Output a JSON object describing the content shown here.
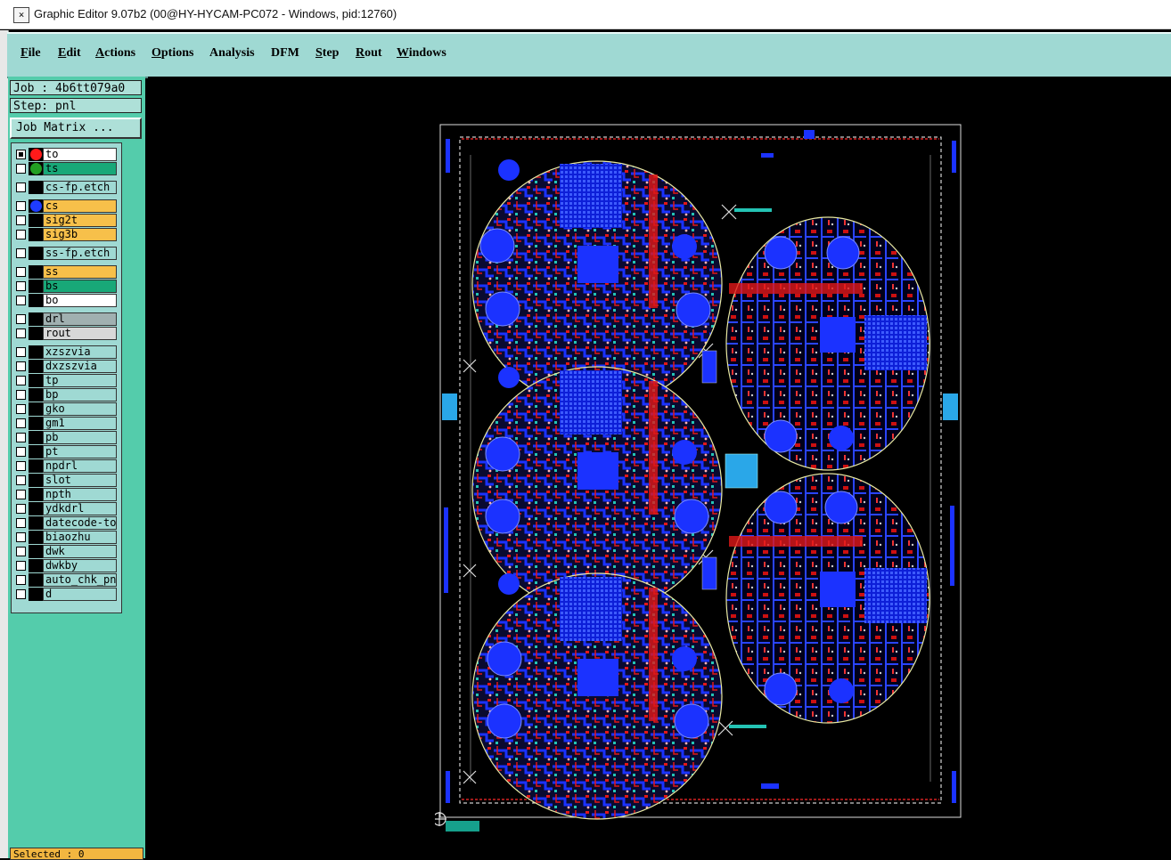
{
  "window": {
    "icon": "app-icon",
    "title": "Graphic Editor 9.07b2 (00@HY-HYCAM-PC072 - Windows, pid:12760)"
  },
  "menu": [
    {
      "first": "F",
      "rest": "ile"
    },
    {
      "first": "E",
      "rest": "dit"
    },
    {
      "first": "A",
      "rest": "ctions"
    },
    {
      "first": "O",
      "rest": "ptions"
    },
    {
      "first": "A",
      "rest": "nalysis"
    },
    {
      "first": "D",
      "rest": "FM"
    },
    {
      "first": "S",
      "rest": "tep"
    },
    {
      "first": "R",
      "rest": "out"
    },
    {
      "first": "W",
      "rest": "indows"
    }
  ],
  "job_label": "Job : 4b6tt079a0",
  "step_label": "Step: pnl",
  "job_matrix_button": "Job Matrix ...",
  "layers": [
    {
      "name": "to",
      "bg": "#ffffff",
      "dot": "#ff1a1a",
      "checked": true
    },
    {
      "name": "ts",
      "bg": "#18a878",
      "dot": "#22a022",
      "checked": false
    },
    {
      "name": "cs-fp.etch",
      "bg": "#9fd9d3",
      "dot": "",
      "checked": false
    },
    {
      "name": "cs",
      "bg": "#f7c04a",
      "dot": "#1e3cff",
      "checked": false
    },
    {
      "name": "sig2t",
      "bg": "#f7c04a",
      "dot": "",
      "checked": false
    },
    {
      "name": "sig3b",
      "bg": "#f7c04a",
      "dot": "",
      "checked": false
    },
    {
      "name": "ss-fp.etch",
      "bg": "#9fd9d3",
      "dot": "",
      "checked": false
    },
    {
      "name": "ss",
      "bg": "#f7c04a",
      "dot": "",
      "checked": false
    },
    {
      "name": "bs",
      "bg": "#18a878",
      "dot": "",
      "checked": false
    },
    {
      "name": "bo",
      "bg": "#ffffff",
      "dot": "",
      "checked": false
    },
    {
      "name": "drl",
      "bg": "#a0b0b0",
      "dot": "",
      "checked": false
    },
    {
      "name": "rout",
      "bg": "#d8d8d8",
      "dot": "",
      "checked": false
    },
    {
      "name": "xzszvia",
      "bg": "#9fd9d3",
      "dot": "",
      "checked": false
    },
    {
      "name": "dxzszvia",
      "bg": "#9fd9d3",
      "dot": "",
      "checked": false
    },
    {
      "name": "tp",
      "bg": "#9fd9d3",
      "dot": "",
      "checked": false
    },
    {
      "name": "bp",
      "bg": "#9fd9d3",
      "dot": "",
      "checked": false
    },
    {
      "name": "gko",
      "bg": "#9fd9d3",
      "dot": "",
      "checked": false
    },
    {
      "name": "gm1",
      "bg": "#9fd9d3",
      "dot": "",
      "checked": false
    },
    {
      "name": "pb",
      "bg": "#9fd9d3",
      "dot": "",
      "checked": false
    },
    {
      "name": "pt",
      "bg": "#9fd9d3",
      "dot": "",
      "checked": false
    },
    {
      "name": "npdrl",
      "bg": "#9fd9d3",
      "dot": "",
      "checked": false
    },
    {
      "name": "slot",
      "bg": "#9fd9d3",
      "dot": "",
      "checked": false
    },
    {
      "name": "npth",
      "bg": "#9fd9d3",
      "dot": "",
      "checked": false
    },
    {
      "name": "ydkdrl",
      "bg": "#9fd9d3",
      "dot": "",
      "checked": false
    },
    {
      "name": "datecode-to",
      "bg": "#9fd9d3",
      "dot": "",
      "checked": false
    },
    {
      "name": "biaozhu",
      "bg": "#9fd9d3",
      "dot": "",
      "checked": false
    },
    {
      "name": "dwk",
      "bg": "#9fd9d3",
      "dot": "",
      "checked": false
    },
    {
      "name": "dwkby",
      "bg": "#9fd9d3",
      "dot": "",
      "checked": false
    },
    {
      "name": "auto_chk_pn",
      "bg": "#9fd9d3",
      "dot": "",
      "checked": false
    },
    {
      "name": "d",
      "bg": "#9fd9d3",
      "dot": "",
      "checked": false
    }
  ],
  "status": "Selected : 0"
}
